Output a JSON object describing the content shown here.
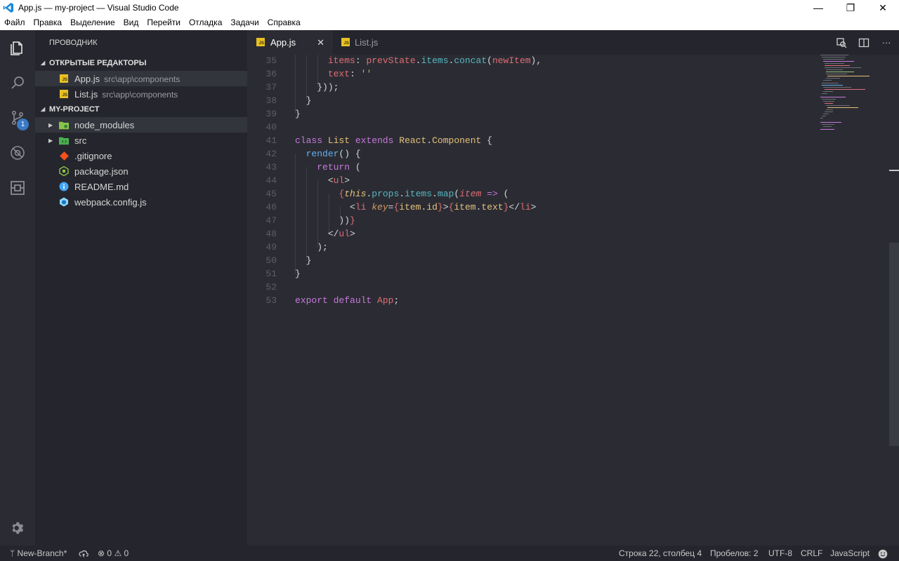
{
  "window": {
    "title": "App.js — my-project — Visual Studio Code",
    "controls": {
      "minimize": "—",
      "restore": "❐",
      "close": "✕"
    }
  },
  "menu": [
    "Файл",
    "Правка",
    "Выделение",
    "Вид",
    "Перейти",
    "Отладка",
    "Задачи",
    "Справка"
  ],
  "activity_bar": {
    "scm_badge": "1"
  },
  "sidebar": {
    "header": "ПРОВОДНИК",
    "open_editors": {
      "title": "ОТКРЫТЫЕ РЕДАКТОРЫ",
      "items": [
        {
          "name": "App.js",
          "path": "src\\app\\components"
        },
        {
          "name": "List.js",
          "path": "src\\app\\components"
        }
      ]
    },
    "project": {
      "title": "MY-PROJECT",
      "items": [
        {
          "name": "node_modules"
        },
        {
          "name": "src"
        },
        {
          "name": ".gitignore"
        },
        {
          "name": "package.json"
        },
        {
          "name": "README.md"
        },
        {
          "name": "webpack.config.js"
        }
      ]
    }
  },
  "tabs": [
    {
      "label": "App.js",
      "active": true,
      "close": "✕"
    },
    {
      "label": "List.js",
      "active": false
    }
  ],
  "editor_actions": {
    "more": "···"
  },
  "code": {
    "line_numbers": [
      "35",
      "36",
      "37",
      "38",
      "39",
      "40",
      "41",
      "42",
      "43",
      "44",
      "45",
      "46",
      "47",
      "48",
      "49",
      "50",
      "51",
      "52",
      "53"
    ]
  },
  "status": {
    "branch": "New-Branch*",
    "errors": "0",
    "warnings": "0",
    "position": "Строка 22, столбец 4",
    "spaces": "Пробелов: 2",
    "encoding": "UTF-8",
    "eol": "CRLF",
    "language": "JavaScript"
  },
  "colors": {
    "accent": "#3a79c6",
    "js_icon": "#e8c024",
    "keyword": "#c678dd",
    "class_name": "#e5c07b",
    "function": "#61afef",
    "property": "#e06c75",
    "string": "#98c379"
  }
}
